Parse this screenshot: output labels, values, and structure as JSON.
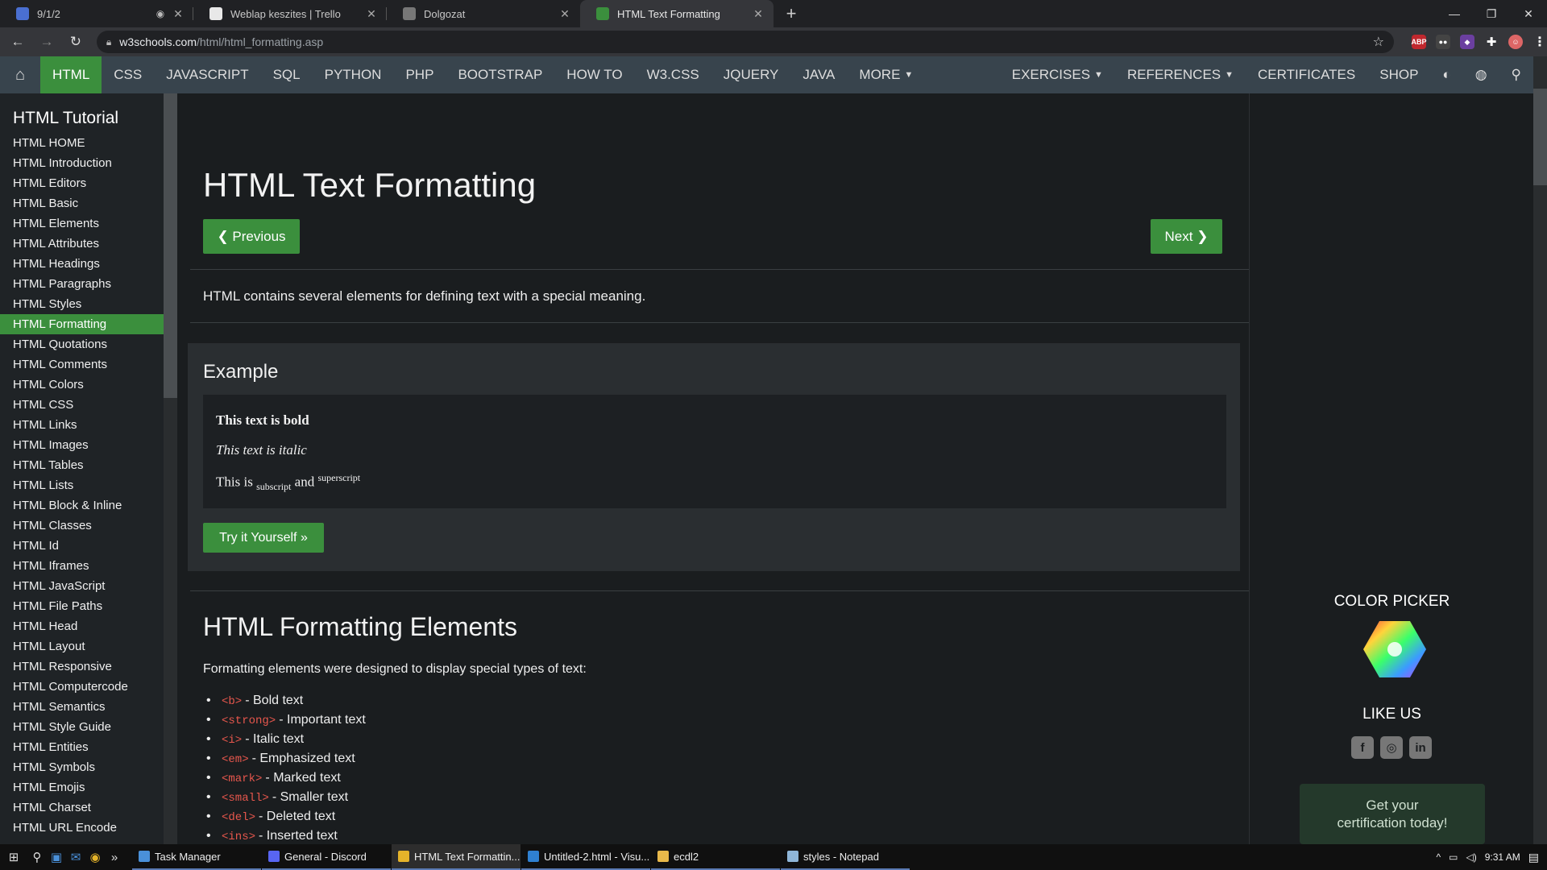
{
  "browser": {
    "tabs": [
      {
        "title": "9/1/2",
        "icon": "docs-icon",
        "icon_color": "#4a6fd1",
        "active": false,
        "audio": true
      },
      {
        "title": "Weblap keszites | Trello",
        "icon": "trello-icon",
        "icon_color": "#e8e8e8",
        "active": false,
        "audio": false
      },
      {
        "title": "Dolgozat",
        "icon": "globe-icon",
        "icon_color": "#777777",
        "active": false,
        "audio": false
      },
      {
        "title": "HTML Text Formatting",
        "icon": "w3schools-icon",
        "icon_color": "#3b8f3d",
        "active": true,
        "audio": false
      }
    ],
    "new_tab": "+",
    "url_host": "w3schools.com",
    "url_path": "/html/html_formatting.asp",
    "window_controls": {
      "minimize": "—",
      "restore": "❐",
      "close": "✕"
    }
  },
  "topnav": {
    "items": [
      "HTML",
      "CSS",
      "JAVASCRIPT",
      "SQL",
      "PYTHON",
      "PHP",
      "BOOTSTRAP",
      "HOW TO",
      "W3.CSS",
      "JQUERY",
      "JAVA",
      "MORE"
    ],
    "active": "HTML",
    "right_items": [
      "EXERCISES",
      "REFERENCES",
      "CERTIFICATES",
      "SHOP"
    ],
    "accent": "#3b8f3d"
  },
  "sidebar": {
    "title": "HTML Tutorial",
    "items": [
      "HTML HOME",
      "HTML Introduction",
      "HTML Editors",
      "HTML Basic",
      "HTML Elements",
      "HTML Attributes",
      "HTML Headings",
      "HTML Paragraphs",
      "HTML Styles",
      "HTML Formatting",
      "HTML Quotations",
      "HTML Comments",
      "HTML Colors",
      "HTML CSS",
      "HTML Links",
      "HTML Images",
      "HTML Tables",
      "HTML Lists",
      "HTML Block & Inline",
      "HTML Classes",
      "HTML Id",
      "HTML Iframes",
      "HTML JavaScript",
      "HTML File Paths",
      "HTML Head",
      "HTML Layout",
      "HTML Responsive",
      "HTML Computercode",
      "HTML Semantics",
      "HTML Style Guide",
      "HTML Entities",
      "HTML Symbols",
      "HTML Emojis",
      "HTML Charset",
      "HTML URL Encode"
    ],
    "selected": "HTML Formatting"
  },
  "main": {
    "title": "HTML Text Formatting",
    "prev_label": "❮ Previous",
    "next_label": "Next ❯",
    "intro": "HTML contains several elements for defining text with a special meaning.",
    "example": {
      "heading": "Example",
      "bold_text": "This text is bold",
      "italic_text": "This text is italic",
      "sub_prefix": "This is ",
      "sub_text": "subscript",
      "sub_mid": " and ",
      "sup_text": "superscript",
      "try_label": "Try it Yourself »"
    },
    "section_title": "HTML Formatting Elements",
    "section_desc": "Formatting elements were designed to display special types of text:",
    "elements": [
      {
        "tag": "<b>",
        "desc": "- Bold text"
      },
      {
        "tag": "<strong>",
        "desc": "- Important text"
      },
      {
        "tag": "<i>",
        "desc": "- Italic text"
      },
      {
        "tag": "<em>",
        "desc": "- Emphasized text"
      },
      {
        "tag": "<mark>",
        "desc": "- Marked text"
      },
      {
        "tag": "<small>",
        "desc": "- Smaller text"
      },
      {
        "tag": "<del>",
        "desc": "- Deleted text"
      },
      {
        "tag": "<ins>",
        "desc": "- Inserted text"
      }
    ]
  },
  "rightcol": {
    "color_picker": "COLOR PICKER",
    "like_us": "LIKE US",
    "cert_line1": "Get your",
    "cert_line2": "certification today!"
  },
  "taskbar": {
    "tasks": [
      {
        "label": "Task Manager",
        "color": "#4a90d9"
      },
      {
        "label": "General - Discord",
        "color": "#5865f2"
      },
      {
        "label": "HTML Text Formattin...",
        "color": "#e5b32a",
        "active": true
      },
      {
        "label": "Untitled-2.html - Visu...",
        "color": "#2f80d1"
      },
      {
        "label": "ecdl2",
        "color": "#e8b84a"
      },
      {
        "label": "styles - Notepad",
        "color": "#8fb6d8"
      }
    ],
    "time": "9:31 AM"
  }
}
